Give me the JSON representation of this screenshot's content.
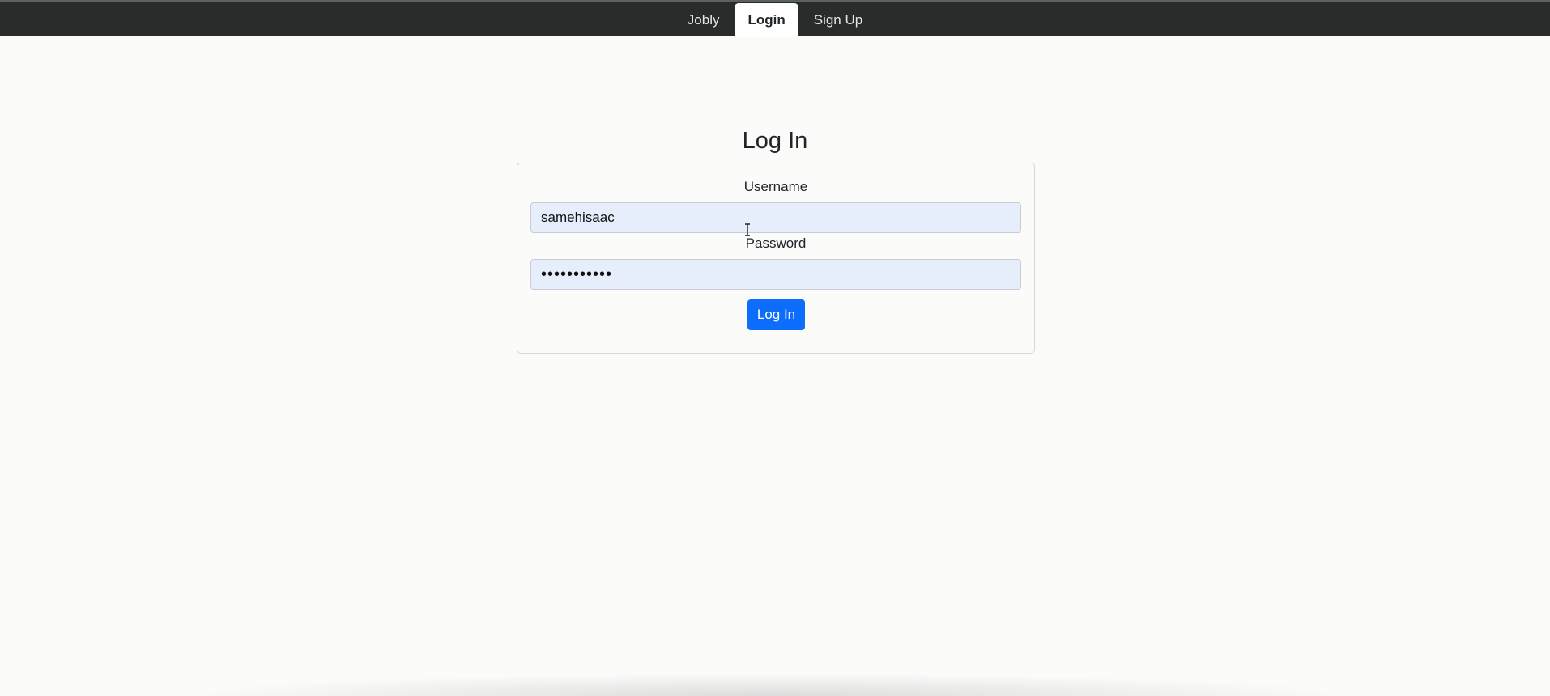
{
  "nav": {
    "items": [
      {
        "label": "Jobly"
      },
      {
        "label": "Login"
      },
      {
        "label": "Sign Up"
      }
    ],
    "active_index": 1
  },
  "login_form": {
    "title": "Log In",
    "username": {
      "label": "Username",
      "value": "samehisaac"
    },
    "password": {
      "label": "Password",
      "value": "•••••••••••"
    },
    "submit_label": "Log In"
  },
  "colors": {
    "navbar_bg": "#2a2c2c",
    "primary_button": "#0d6efd",
    "autofill_bg": "#e7eefb"
  },
  "icons": {
    "text_cursor": "i-beam-cursor-icon"
  }
}
